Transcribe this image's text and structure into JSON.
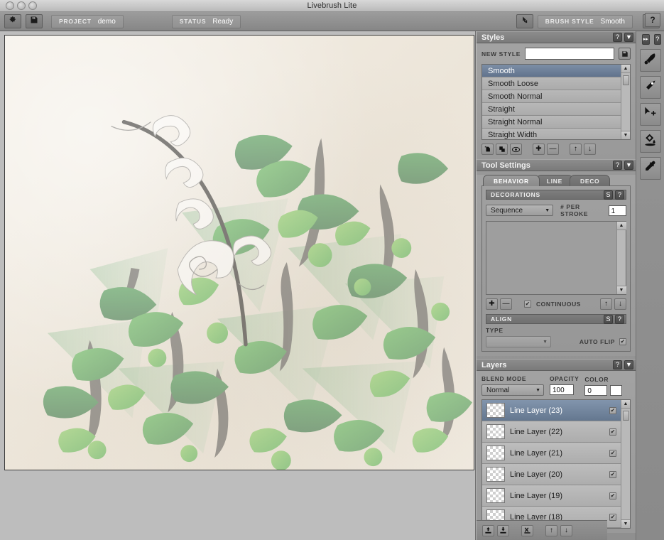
{
  "window": {
    "title": "Livebrush Lite",
    "traffic_lights": [
      "close",
      "minimize",
      "zoom"
    ]
  },
  "toolbar": {
    "settings_icon": "gear-icon",
    "save_icon": "save-disk-icon",
    "project_label": "PROJECT",
    "project_value": "demo",
    "status_label": "STATUS",
    "status_value": "Ready",
    "brush_toggle_icon": "brush-cursor-icon",
    "brush_style_label": "BRUSH STYLE",
    "brush_style_value": "Smooth",
    "help_label": "?"
  },
  "styles_panel": {
    "title": "Styles",
    "help_label": "?",
    "collapse_label": "▼",
    "new_style_label": "NEW STYLE",
    "new_style_value": "",
    "save_icon": "save-disk-icon",
    "items": [
      {
        "label": "Smooth",
        "selected": true
      },
      {
        "label": "Smooth Loose",
        "selected": false
      },
      {
        "label": "Smooth Normal",
        "selected": false
      },
      {
        "label": "Straight",
        "selected": false
      },
      {
        "label": "Straight Normal",
        "selected": false
      },
      {
        "label": "Straight Width",
        "selected": false
      }
    ],
    "buttons": [
      {
        "name": "new-style-button",
        "glyph": "＋"
      },
      {
        "name": "duplicate-style-button",
        "glyph": "❐"
      },
      {
        "name": "preview-style-button",
        "glyph": "◉"
      },
      {
        "name": "add-button",
        "glyph": "✚"
      },
      {
        "name": "remove-button",
        "glyph": "—"
      },
      {
        "name": "move-up-button",
        "glyph": "↑"
      },
      {
        "name": "move-down-button",
        "glyph": "↓"
      }
    ]
  },
  "tool_settings_panel": {
    "title": "Tool Settings",
    "help_label": "?",
    "collapse_label": "▼",
    "tabs": [
      {
        "label": "BEHAVIOR",
        "active": false
      },
      {
        "label": "LINE",
        "active": false
      },
      {
        "label": "DECO",
        "active": true
      }
    ],
    "decorations": {
      "title": "DECORATIONS",
      "reset_label": "S",
      "help_label": "?",
      "mode_value": "Sequence",
      "per_stroke_label": "# PER STROKE",
      "per_stroke_value": "1"
    },
    "deco_toolbar": {
      "add_label": "✚",
      "remove_label": "—",
      "continuous_label": "CONTINUOUS",
      "continuous_checked": true,
      "up_label": "↑",
      "down_label": "↓"
    },
    "align": {
      "title": "ALIGN",
      "reset_label": "S",
      "help_label": "?",
      "type_label": "TYPE",
      "type_value": "",
      "auto_flip_label": "AUTO FLIP",
      "auto_flip_checked": true
    }
  },
  "layers_panel": {
    "title": "Layers",
    "help_label": "?",
    "collapse_label": "▼",
    "blend_mode_label": "BLEND MODE",
    "blend_mode_value": "Normal",
    "opacity_label": "OPACITY",
    "opacity_value": "100",
    "color_label": "COLOR",
    "color_value": "0",
    "color_swatch": "#ffffff",
    "layers": [
      {
        "name": "Line Layer (23)",
        "visible": true,
        "selected": true
      },
      {
        "name": "Line Layer (22)",
        "visible": true,
        "selected": false
      },
      {
        "name": "Line Layer (21)",
        "visible": true,
        "selected": false
      },
      {
        "name": "Line Layer (20)",
        "visible": true,
        "selected": false
      },
      {
        "name": "Line Layer (19)",
        "visible": true,
        "selected": false
      },
      {
        "name": "Line Layer (18)",
        "visible": true,
        "selected": false
      }
    ],
    "footer_buttons": [
      {
        "name": "add-layer-button",
        "glyph": "↥"
      },
      {
        "name": "duplicate-layer-button",
        "glyph": "↧"
      },
      {
        "name": "delete-layer-button",
        "glyph": "✕"
      },
      {
        "name": "layer-up-button",
        "glyph": "↑"
      },
      {
        "name": "layer-down-button",
        "glyph": "↓"
      }
    ]
  },
  "tool_rail": {
    "expand_label": "▸▸",
    "help_label": "?",
    "tools": [
      {
        "name": "brush-tool",
        "icon": "brush-icon",
        "active": false
      },
      {
        "name": "pen-tool",
        "icon": "pen-icon",
        "active": false
      },
      {
        "name": "move-tool",
        "icon": "move-select-icon",
        "active": false
      },
      {
        "name": "fill-tool",
        "icon": "paint-bucket-icon",
        "active": false
      },
      {
        "name": "eyedropper-tool",
        "icon": "eyedropper-icon",
        "active": false
      }
    ]
  },
  "canvas": {
    "background_color": "#f2ece2",
    "artwork_colors": {
      "leaf_light": "#6ec24a",
      "leaf_mid": "#3da83d",
      "leaf_dark": "#2d8a3e",
      "leaf_deep": "#1f6b33",
      "stroke_dark": "#3f3f3f",
      "white_swirl": "#ffffff"
    }
  }
}
